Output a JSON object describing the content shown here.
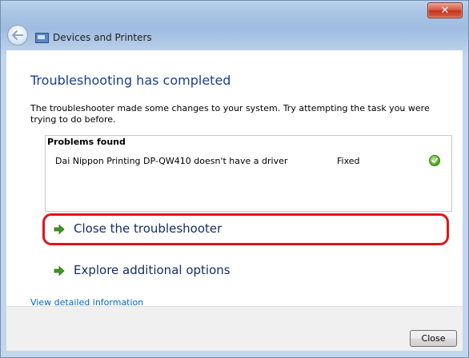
{
  "window": {
    "close_glyph": "✕",
    "accent_close_color": "#c2321b"
  },
  "navbar": {
    "title": "Devices and Printers",
    "back_icon": "back-arrow-icon",
    "location_icon": "devices-and-printers-icon"
  },
  "main": {
    "heading": "Troubleshooting has completed",
    "description": "The troubleshooter made some changes to your system. Try attempting the task you were trying to do before.",
    "problems": {
      "title": "Problems found",
      "rows": [
        {
          "text": "Dai Nippon Printing DP-QW410 doesn't have a driver",
          "status": "Fixed",
          "icon": "green-check-icon"
        }
      ]
    },
    "actions": [
      {
        "label": "Close the troubleshooter",
        "icon": "green-arrow-icon"
      },
      {
        "label": "Explore additional options",
        "icon": "green-arrow-icon"
      }
    ],
    "detail_link": "View detailed information",
    "heading_color": "#193f8c",
    "link_color": "#0066cc",
    "highlight_color": "#e1141b"
  },
  "footer": {
    "close_label": "Close"
  }
}
